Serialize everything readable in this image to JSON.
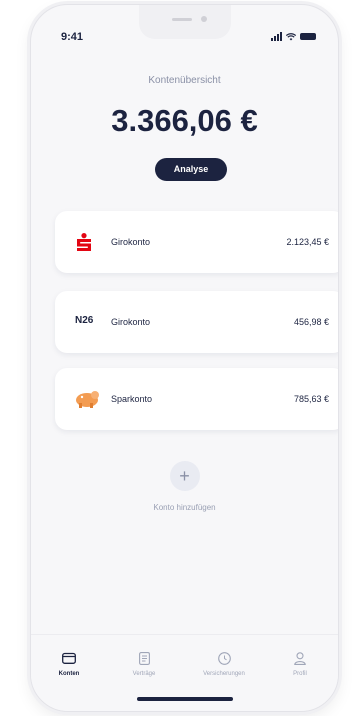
{
  "status": {
    "time": "9:41"
  },
  "header": {
    "title": "Kontenübersicht",
    "balance": "3.366,06 €",
    "analyse_label": "Analyse"
  },
  "accounts": [
    {
      "name": "Girokonto",
      "amount": "2.123,45 €",
      "logo": "sparkasse-logo",
      "logo_color": "#e30613"
    },
    {
      "name": "Girokonto",
      "amount": "456,98 €",
      "logo": "n26-logo",
      "logo_text": "N26"
    },
    {
      "name": "Sparkonto",
      "amount": "785,63 €",
      "logo": "piggy-bank-icon",
      "logo_color": "#f39c52"
    }
  ],
  "add_account": {
    "label": "Konto hinzufügen"
  },
  "tabbar": {
    "items": [
      {
        "label": "Konten",
        "icon": "wallet-icon",
        "active": true
      },
      {
        "label": "Verträge",
        "icon": "document-icon",
        "active": false
      },
      {
        "label": "Versicherungen",
        "icon": "shield-clock-icon",
        "active": false
      },
      {
        "label": "Profil",
        "icon": "user-icon",
        "active": false
      }
    ]
  },
  "colors": {
    "primary": "#1c2340",
    "sparkasse": "#e30613",
    "muted": "#8a90a6"
  }
}
